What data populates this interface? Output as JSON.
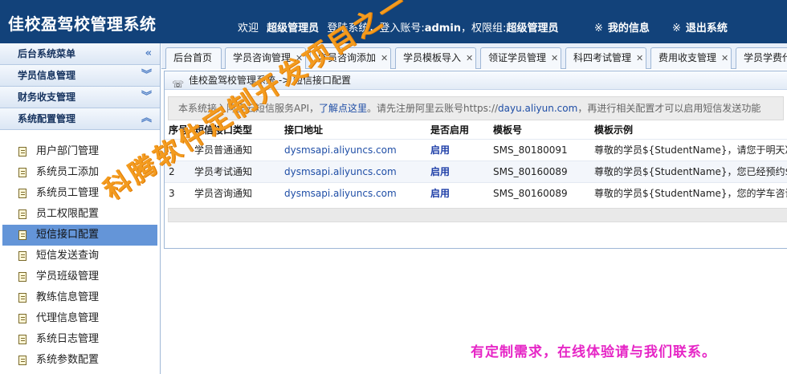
{
  "header": {
    "title": "佳校盈驾校管理系统",
    "welcome_prefix": "欢迎",
    "user_name": "超级管理员",
    "login_text": "登陆系统，登入账号:",
    "account": "admin",
    "group_text": "，权限组:",
    "group": "超级管理员",
    "my_info": "我的信息",
    "logout": "退出系统",
    "mark": "※"
  },
  "sidebar": {
    "menu_title": "后台系统菜单",
    "sections": [
      {
        "label": "学员信息管理"
      },
      {
        "label": "财务收支管理"
      },
      {
        "label": "系统配置管理"
      }
    ],
    "items": [
      {
        "label": "用户部门管理"
      },
      {
        "label": "系统员工添加"
      },
      {
        "label": "系统员工管理"
      },
      {
        "label": "员工权限配置"
      },
      {
        "label": "短信接口配置",
        "active": true
      },
      {
        "label": "短信发送查询"
      },
      {
        "label": "学员班级管理"
      },
      {
        "label": "教练信息管理"
      },
      {
        "label": "代理信息管理"
      },
      {
        "label": "系统日志管理"
      },
      {
        "label": "系统参数配置"
      }
    ]
  },
  "tabs": [
    {
      "label": "后台首页"
    },
    {
      "label": "学员咨询管理"
    },
    {
      "label": "学员咨询添加"
    },
    {
      "label": "学员模板导入"
    },
    {
      "label": "领证学员管理"
    },
    {
      "label": "科四考试管理"
    },
    {
      "label": "费用收支管理"
    },
    {
      "label": "学员学费代"
    }
  ],
  "content": {
    "breadcrumb": "佳校盈驾校管理系统 -> 短信接口配置",
    "notice_prefix": "本系统接入阿里云短信服务API，",
    "notice_link": "了解点这里",
    "notice_mid": "。请先注册阿里云账号https://",
    "notice_url": "dayu.aliyun.com",
    "notice_suffix": "，再进行相关配置才可以启用短信发送功能"
  },
  "table": {
    "columns": [
      "序号",
      "短信接口类型",
      "接口地址",
      "是否启用",
      "模板号",
      "模板示例"
    ],
    "rows": [
      {
        "no": "1",
        "type": "学员普通通知",
        "url": "dysmsapi.aliyuncs.com",
        "enabled": "启用",
        "template": "SMS_80180091",
        "example": "尊敬的学员${StudentName}，请您于明天准时"
      },
      {
        "no": "2",
        "type": "学员考试通知",
        "url": "dysmsapi.aliyuncs.com",
        "enabled": "启用",
        "template": "SMS_80160089",
        "example": "尊敬的学员${StudentName}，您已经预约${"
      },
      {
        "no": "3",
        "type": "学员咨询通知",
        "url": "dysmsapi.aliyuncs.com",
        "enabled": "启用",
        "template": "SMS_80160089",
        "example": "尊敬的学员${StudentName}，您的学车咨询我"
      }
    ]
  },
  "watermark": {
    "diagonal": "科腾软件定制开发项目之一",
    "contact": "有定制需求，在线体验请与我们联系。"
  },
  "colors": {
    "header_bg": "#12427a",
    "active_item_bg": "#6495d8",
    "watermark_orange": "#f39b1f",
    "watermark_magenta": "#e626c6"
  },
  "icons": {
    "collapse": "double-chevron-left-icon",
    "section_collapsed": "double-chevron-down-icon",
    "section_expanded": "double-chevron-up-icon",
    "menu_item": "document-icon",
    "breadcrumb": "location-icon",
    "tab_close": "close-icon"
  }
}
